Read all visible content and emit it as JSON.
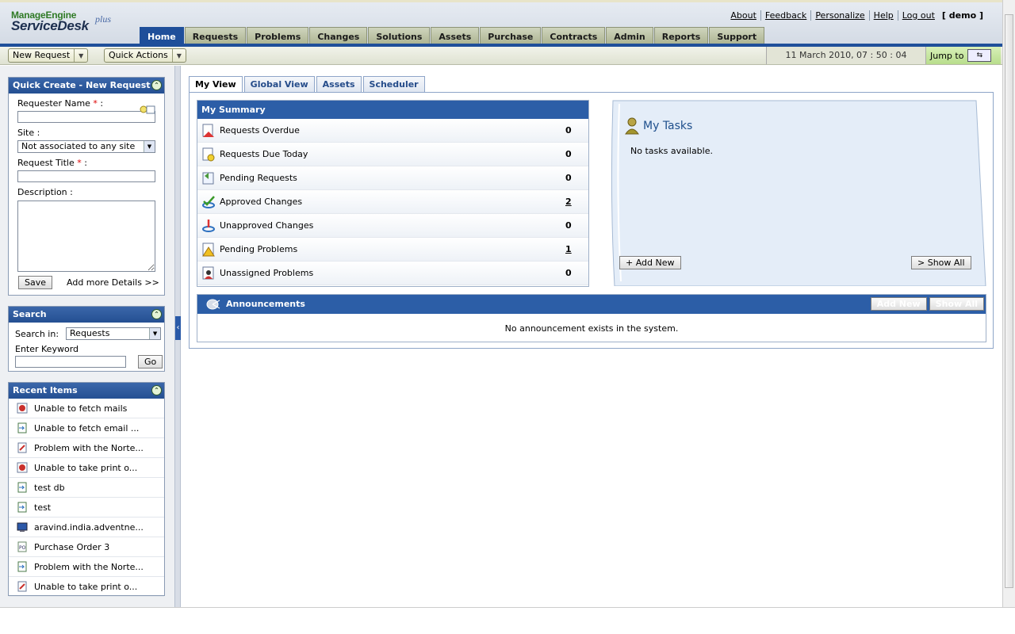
{
  "app": {
    "logo_top": "ManageEngine",
    "logo_main": "ServiceDesk",
    "logo_plus": "plus"
  },
  "toplinks": [
    "About",
    "Feedback",
    "Personalize",
    "Help",
    "Log out"
  ],
  "user": "[ demo ]",
  "nav": {
    "tabs": [
      "Home",
      "Requests",
      "Problems",
      "Changes",
      "Solutions",
      "Assets",
      "Purchase",
      "Contracts",
      "Admin",
      "Reports",
      "Support"
    ],
    "active": "Home"
  },
  "toolbar": {
    "new_request": "New Request",
    "quick_actions": "Quick Actions",
    "datetime": "11 March 2010, 07 : 50 : 04",
    "jump_to": "Jump to"
  },
  "quick_create": {
    "title": "Quick Create - New Request",
    "requester_label": "Requester Name",
    "site_label": "Site :",
    "site_value": "Not associated to any site",
    "title_label": "Request Title",
    "description_label": "Description :",
    "save": "Save",
    "more": "Add more Details >>",
    "req_mark": "*",
    "colon": ":"
  },
  "search": {
    "title": "Search",
    "search_in_label": "Search in:",
    "search_in_value": "Requests",
    "keyword_label": "Enter Keyword",
    "go": "Go"
  },
  "recent": {
    "title": "Recent Items",
    "items": [
      {
        "label": "Unable to fetch mails",
        "icon": "problem-icon"
      },
      {
        "label": "Unable to fetch email ...",
        "icon": "request-icon"
      },
      {
        "label": "Problem with the Norte...",
        "icon": "change-icon"
      },
      {
        "label": "Unable to take print o...",
        "icon": "problem-icon"
      },
      {
        "label": "test db",
        "icon": "request-icon"
      },
      {
        "label": "test",
        "icon": "request-icon"
      },
      {
        "label": "aravind.india.adventne...",
        "icon": "workstation-icon"
      },
      {
        "label": "Purchase Order 3",
        "icon": "purchase-order-icon"
      },
      {
        "label": "Problem with the Norte...",
        "icon": "request-icon"
      },
      {
        "label": "Unable to take print o...",
        "icon": "change-icon"
      }
    ]
  },
  "subtabs": [
    "My View",
    "Global View",
    "Assets",
    "Scheduler"
  ],
  "summary": {
    "title": "My Summary",
    "rows": [
      {
        "label": "Requests Overdue",
        "count": "0",
        "link": false,
        "icon": "overdue-icon"
      },
      {
        "label": "Requests Due Today",
        "count": "0",
        "link": false,
        "icon": "due-today-icon"
      },
      {
        "label": "Pending Requests",
        "count": "0",
        "link": false,
        "icon": "pending-request-icon"
      },
      {
        "label": "Approved Changes",
        "count": "2",
        "link": true,
        "icon": "approved-change-icon"
      },
      {
        "label": "Unapproved Changes",
        "count": "0",
        "link": false,
        "icon": "unapproved-change-icon"
      },
      {
        "label": "Pending Problems",
        "count": "1",
        "link": true,
        "icon": "pending-problem-icon"
      },
      {
        "label": "Unassigned Problems",
        "count": "0",
        "link": false,
        "icon": "unassigned-problem-icon"
      }
    ]
  },
  "tasks": {
    "title": "My Tasks",
    "empty": "No tasks available.",
    "add_new": "+ Add New",
    "show_all": "> Show All"
  },
  "announcements": {
    "title": "Announcements",
    "add_new": "Add New",
    "show_all": "Show All",
    "empty": "No announcement exists in the system."
  }
}
